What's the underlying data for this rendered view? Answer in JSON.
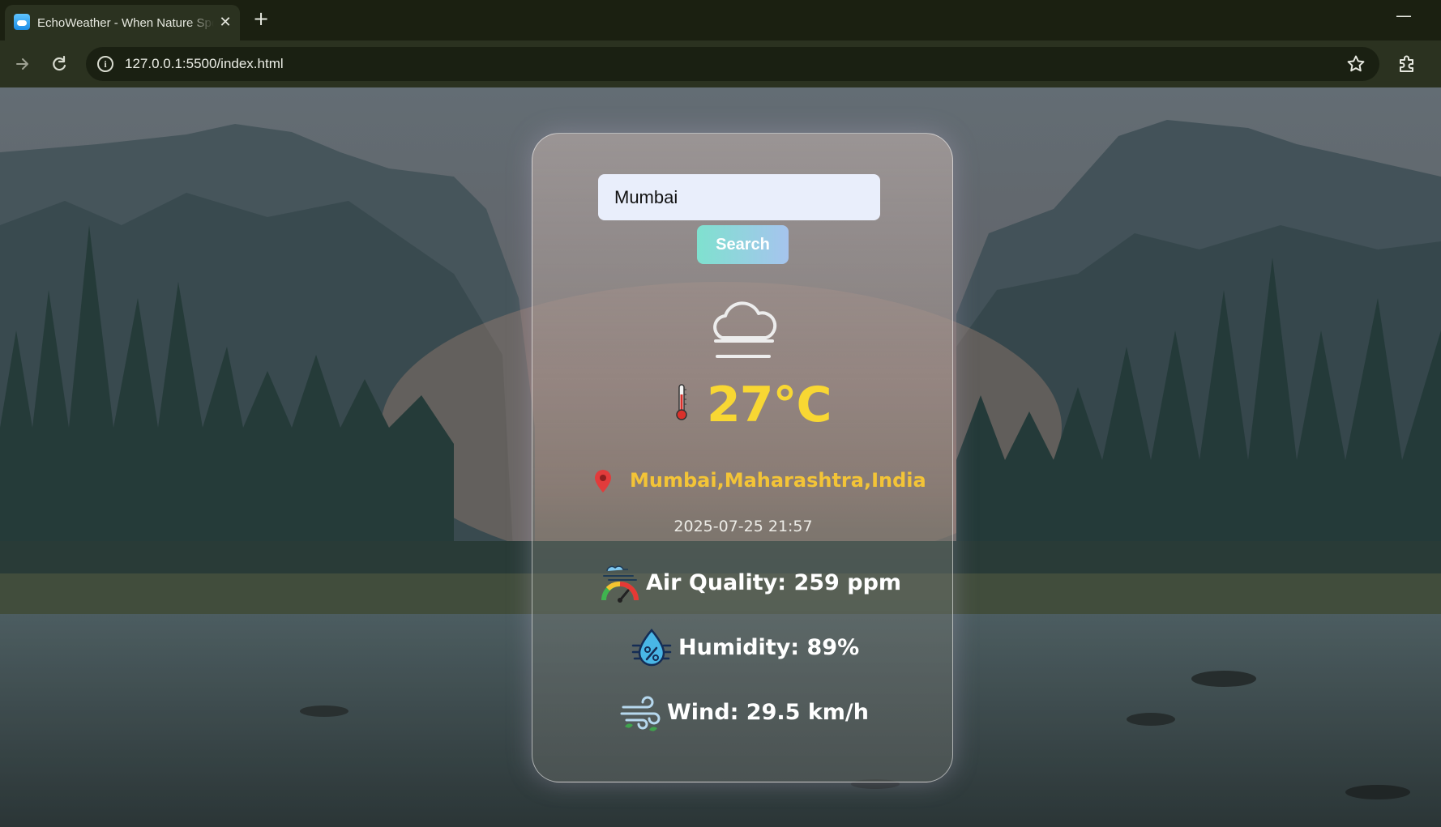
{
  "browser": {
    "tab_title": "EchoWeather - When Nature Speaks",
    "url": "127.0.0.1:5500/index.html",
    "close_glyph": "✕",
    "new_tab_glyph": "+",
    "minimize_glyph": "—"
  },
  "weather": {
    "search": {
      "value": "Mumbai",
      "button_label": "Search"
    },
    "condition_icon": "cloud-fog-icon",
    "temperature": "27°C",
    "location": "Mumbai,Maharashtra,India",
    "datetime": "2025-07-25 21:57",
    "air_quality": {
      "label": "Air Quality:",
      "value": "259 ppm",
      "icon": "air-quality-gauge-icon"
    },
    "humidity": {
      "label": "Humidity:",
      "value": "89%",
      "icon": "humidity-drop-icon"
    },
    "wind": {
      "label": "Wind:",
      "value": "29.5 km/h",
      "icon": "wind-icon"
    }
  },
  "colors": {
    "temperature": "#f8d733",
    "location": "#f3c437",
    "pin": "#e23b3b",
    "input_bg": "#e9eefb"
  }
}
